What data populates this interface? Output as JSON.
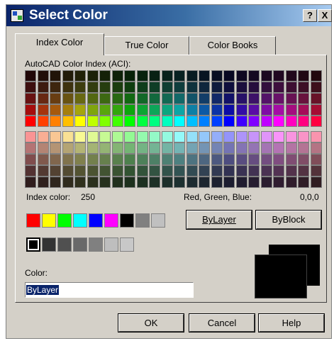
{
  "window": {
    "title": "Select Color",
    "help_btn": "?",
    "close_btn": "X"
  },
  "tabs": [
    {
      "label": "Index Color",
      "active": true
    },
    {
      "label": "True Color",
      "active": false
    },
    {
      "label": "Color Books",
      "active": false
    }
  ],
  "aci_label": "AutoCAD Color Index (ACI):",
  "index_color": {
    "label": "Index color:",
    "value": "250"
  },
  "rgb": {
    "label": "Red, Green, Blue:",
    "value": "0,0,0"
  },
  "standard_colors": [
    "#ff0000",
    "#ffff00",
    "#00ff00",
    "#00ffff",
    "#0000ff",
    "#ff00ff",
    "#000000",
    "#808080",
    "#c0c0c0"
  ],
  "gray_colors": [
    "#000000",
    "#333333",
    "#505050",
    "#696969",
    "#808080",
    "#bebebe",
    "#c8c8c8"
  ],
  "bylayer_btn": "ByLayer",
  "byblock_btn": "ByBlock",
  "color_field": {
    "label": "Color:",
    "value": "ByLayer"
  },
  "preview": {
    "color": "#000000"
  },
  "footer": {
    "ok": "OK",
    "cancel": "Cancel",
    "help": "Help"
  },
  "colors": {
    "titlebar": "#0a246a",
    "dialog_bg": "#d4d0c8",
    "selection": "#0a246a"
  }
}
